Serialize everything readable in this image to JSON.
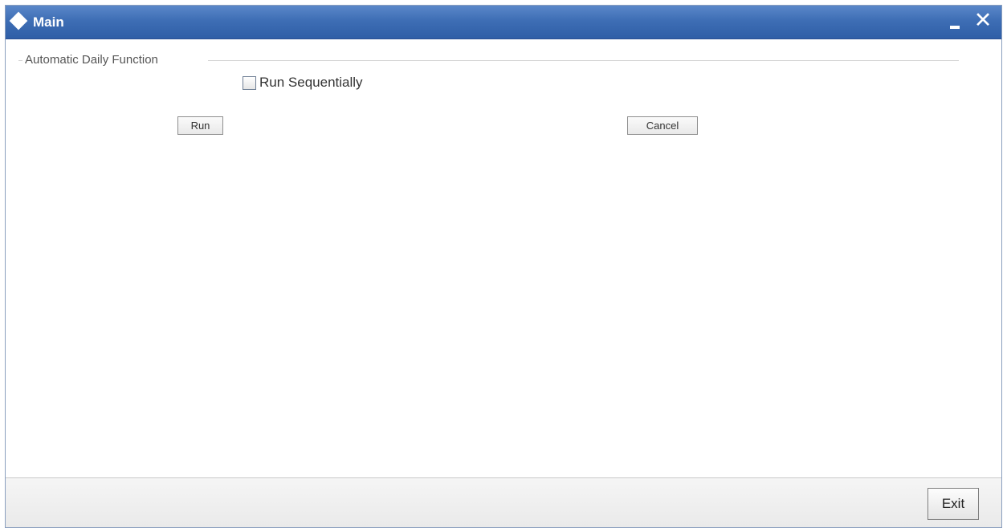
{
  "window": {
    "title": "Main",
    "minimize_label": "–",
    "close_label": "✕"
  },
  "fieldset": {
    "legend": "Automatic Daily Function"
  },
  "options": {
    "run_sequentially_label": "Run Sequentially",
    "run_sequentially_checked": false
  },
  "actions": {
    "run_label": "Run",
    "cancel_label": "Cancel"
  },
  "footer": {
    "exit_label": "Exit"
  },
  "colors": {
    "titlebar": "#3e6eb5",
    "border": "#8a9fbf"
  }
}
